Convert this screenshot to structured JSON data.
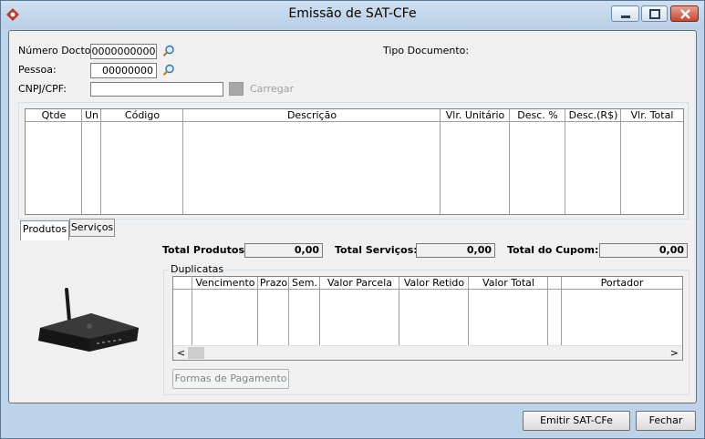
{
  "window": {
    "title": "Emissão de SAT-CFe"
  },
  "form": {
    "numero_docto_label": "Número Docto:",
    "numero_docto_value": "0000000000",
    "pessoa_label": "Pessoa:",
    "pessoa_value": "00000000",
    "cnpj_label": "CNPJ/CPF:",
    "cnpj_value": "",
    "carregar_label": "Carregar",
    "tipo_documento_label": "Tipo Documento:"
  },
  "items_grid": {
    "columns": [
      "Qtde",
      "Un",
      "Código",
      "Descrição",
      "Vlr. Unitário",
      "Desc. %",
      "Desc.(R$)",
      "Vlr. Total"
    ]
  },
  "tabs": {
    "produtos": "Produtos",
    "servicos": "Serviços"
  },
  "totals": {
    "produtos_label": "Total Produtos:",
    "produtos_value": "0,00",
    "servicos_label": "Total Serviços:",
    "servicos_value": "0,00",
    "cupom_label": "Total do Cupom:",
    "cupom_value": "0,00"
  },
  "duplicatas": {
    "title": "Duplicatas",
    "columns": [
      "",
      "Vencimento",
      "Prazo",
      "Sem.",
      "Valor Parcela",
      "Valor Retido",
      "Valor Total",
      "",
      "Portador"
    ],
    "formas_pagamento_label": "Formas de Pagamento",
    "scroll_left": "<",
    "scroll_right": ">"
  },
  "footer": {
    "emitir_label": "Emitir SAT-CFe",
    "fechar_label": "Fechar"
  },
  "icons": {
    "app": "app-icon",
    "lookup": "search-icon",
    "device": "sat-device-image"
  },
  "colors": {
    "title_bar": "#bcd3ea",
    "close_button": "#c6462e",
    "client_bg": "#f0f0f0"
  }
}
